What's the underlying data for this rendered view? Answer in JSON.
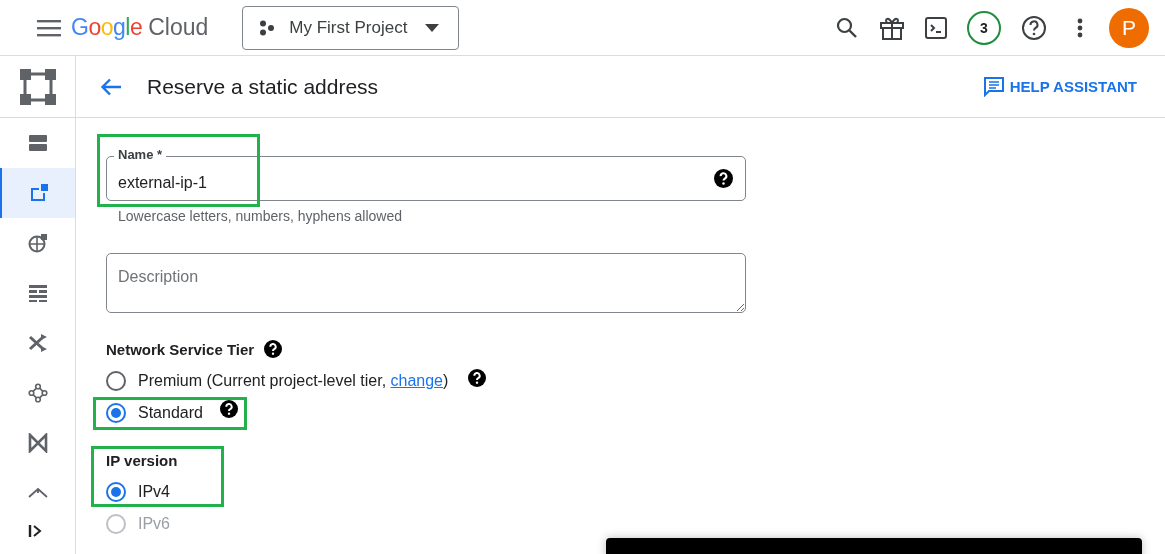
{
  "topbar": {
    "logo": {
      "brand": "Google",
      "product": "Cloud"
    },
    "project": "My First Project",
    "notifications": "3",
    "avatar": "P"
  },
  "sidebar": {
    "items": [
      {
        "selected": false
      },
      {
        "selected": true
      },
      {
        "selected": false
      },
      {
        "selected": false
      },
      {
        "selected": false
      },
      {
        "selected": false
      },
      {
        "selected": false
      },
      {
        "selected": false
      }
    ]
  },
  "header": {
    "title": "Reserve a static address",
    "help": "HELP ASSISTANT"
  },
  "form": {
    "name": {
      "label": "Name *",
      "value": "external-ip-1",
      "hint": "Lowercase letters, numbers, hyphens allowed",
      "highlighted": true
    },
    "description": {
      "placeholder": "Description"
    },
    "tier": {
      "label": "Network Service Tier",
      "options": [
        {
          "label": "Premium (Current project-level tier, ",
          "link": "change",
          "after": ")",
          "selected": false,
          "disabled": false,
          "highlighted": false
        },
        {
          "label": "Standard",
          "selected": true,
          "disabled": false,
          "highlighted": true
        }
      ]
    },
    "ip_version": {
      "label": "IP version",
      "highlighted": true,
      "options": [
        {
          "label": "IPv4",
          "selected": true,
          "disabled": false
        },
        {
          "label": "IPv6",
          "selected": false,
          "disabled": true
        }
      ]
    }
  },
  "snackbar": {
    "visible": true
  }
}
